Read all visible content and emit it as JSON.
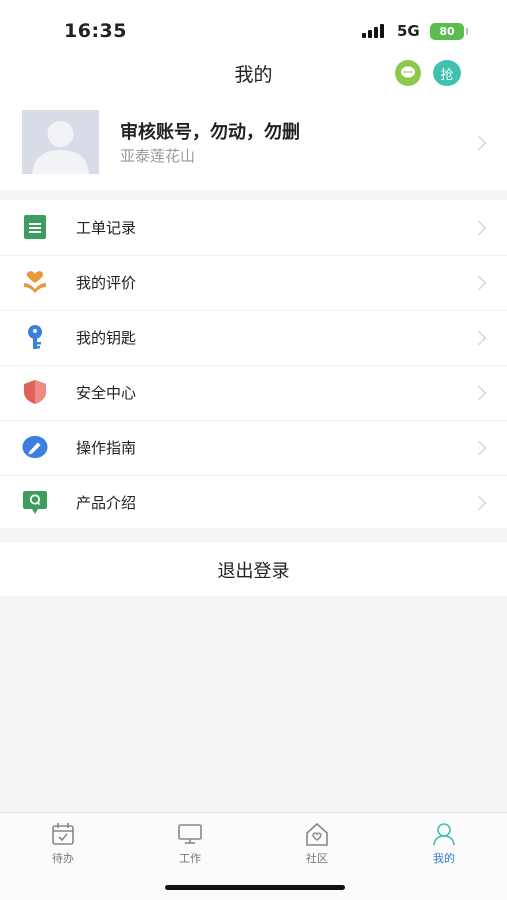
{
  "status": {
    "time": "16:35",
    "network": "5G",
    "battery": "80"
  },
  "header": {
    "title": "我的",
    "grab_label": "抢"
  },
  "profile": {
    "name": "审核账号，勿动，勿删",
    "subtitle": "亚泰莲花山"
  },
  "menu": {
    "items": [
      {
        "label": "工单记录",
        "icon": "document-list-icon"
      },
      {
        "label": "我的评价",
        "icon": "heart-hand-icon"
      },
      {
        "label": "我的钥匙",
        "icon": "key-icon"
      },
      {
        "label": "安全中心",
        "icon": "shield-icon"
      },
      {
        "label": "操作指南",
        "icon": "compass-pen-icon"
      },
      {
        "label": "产品介绍",
        "icon": "chat-q-icon"
      }
    ]
  },
  "logout": {
    "label": "退出登录"
  },
  "tabs": [
    {
      "label": "待办",
      "icon": "calendar-check-icon",
      "active": false
    },
    {
      "label": "工作",
      "icon": "monitor-icon",
      "active": false
    },
    {
      "label": "社区",
      "icon": "house-heart-icon",
      "active": false
    },
    {
      "label": "我的",
      "icon": "person-icon",
      "active": true
    }
  ],
  "colors": {
    "accent": "#3a7bd5",
    "green": "#3e9d5e",
    "orange": "#e79a3a",
    "blue": "#3d7fe0",
    "red": "#e0605a",
    "teal": "#3fc1b0"
  }
}
